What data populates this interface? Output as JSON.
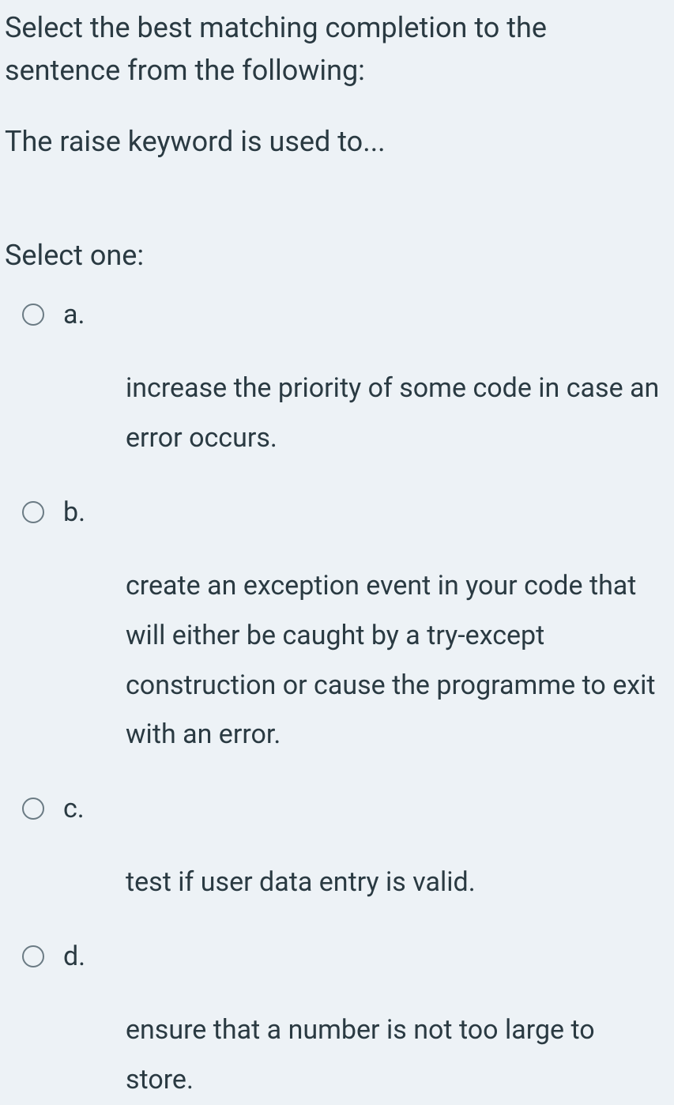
{
  "question": {
    "prompt": "Select the best matching completion to the sentence from the following:",
    "sentence": "The raise keyword is used to...",
    "select_label": "Select one:",
    "options": [
      {
        "letter": "a.",
        "text": "increase the priority of some code in case an error occurs."
      },
      {
        "letter": "b.",
        "text": "create an exception event in your code that will either be caught by a try-except construction or cause the programme to exit with an error."
      },
      {
        "letter": "c.",
        "text": "test if user data entry is valid."
      },
      {
        "letter": "d.",
        "text": "ensure that a number is not too large to store."
      }
    ]
  }
}
